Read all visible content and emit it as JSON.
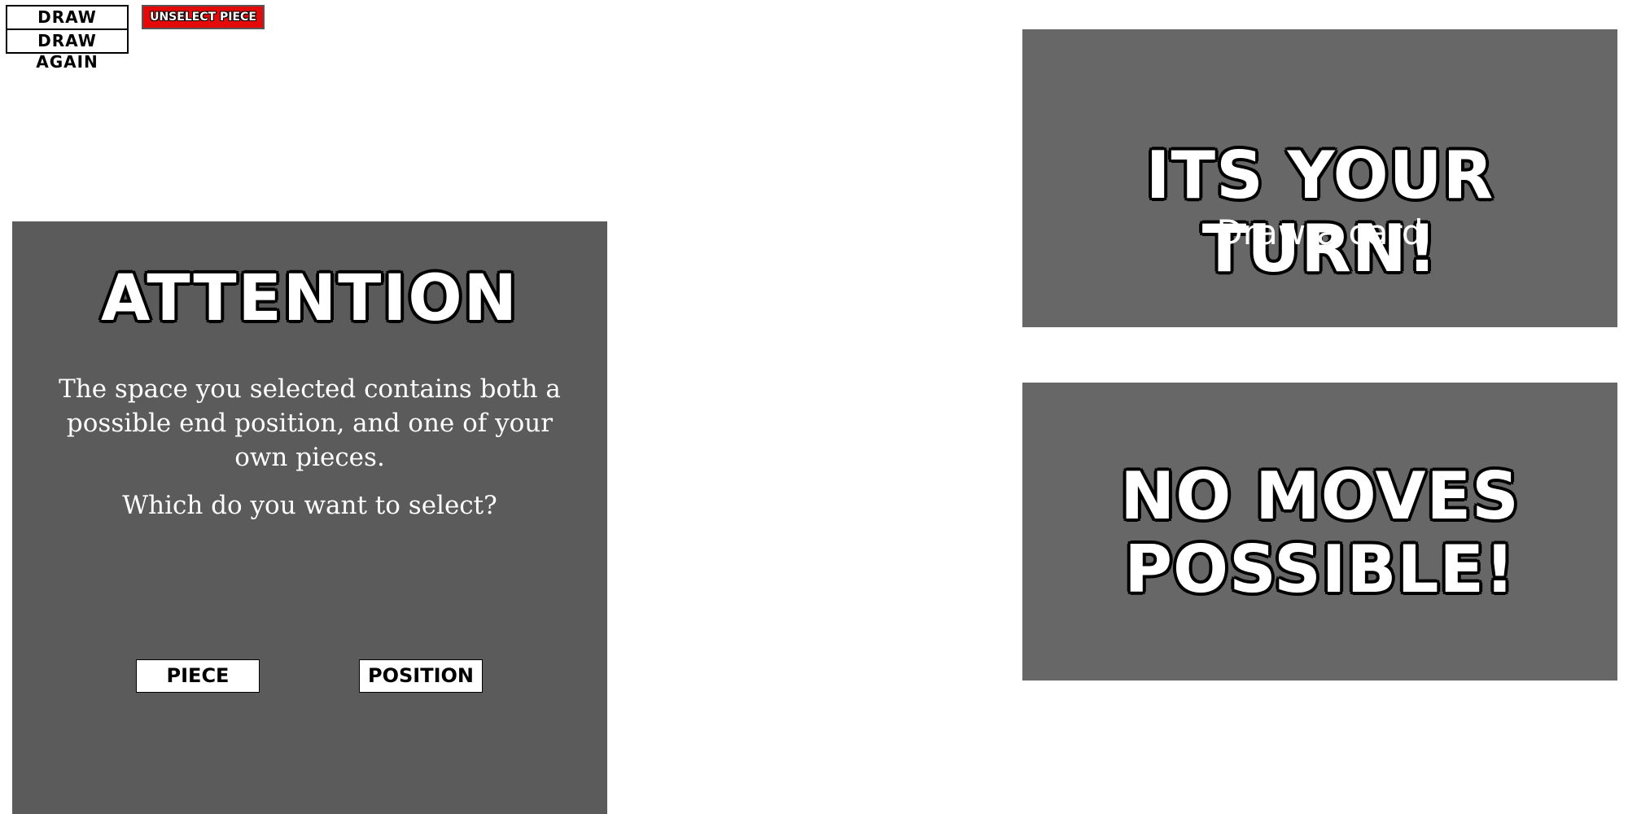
{
  "controls": {
    "draw_label": "DRAW",
    "draw_again_label": "DRAW AGAIN",
    "unselect_label": "UNSELECT PIECE"
  },
  "attention": {
    "title": "ATTENTION",
    "message": "The space you selected contains both a possible end position, and one of your own pieces.",
    "question": "Which do you want to select?",
    "piece_label": "PIECE",
    "position_label": "POSITION"
  },
  "turn": {
    "title": "ITS YOUR TURN!",
    "subtitle": "Draw a card"
  },
  "no_moves": {
    "line1": "NO MOVES",
    "line2": "POSSIBLE!"
  },
  "colors": {
    "attention_panel": "#5b5b5b",
    "info_panel": "#676767",
    "unselect_button": "#e40a0a"
  }
}
